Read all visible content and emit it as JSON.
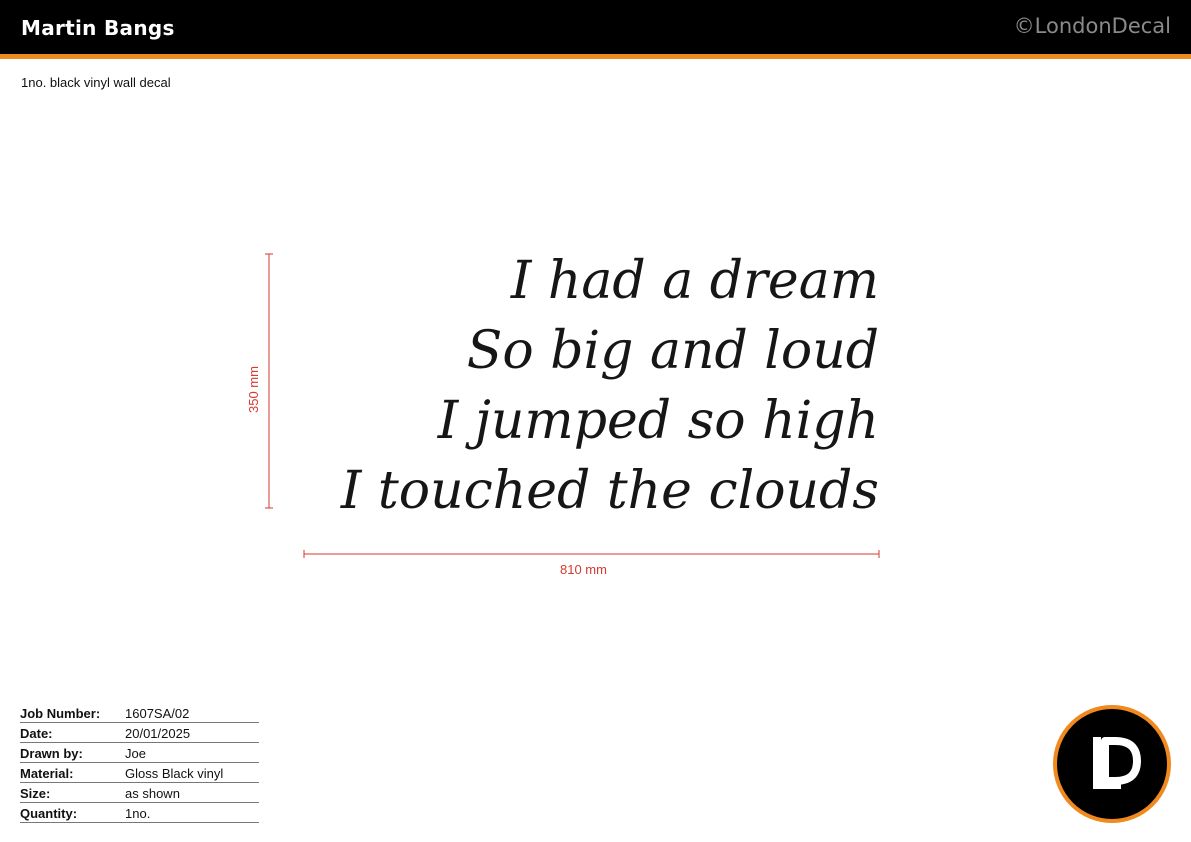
{
  "header": {
    "client_name": "Martin Bangs",
    "copyright": "©LondonDecal",
    "accent_color": "#f0891e",
    "background_color": "#000000"
  },
  "subtitle": "1no. black vinyl wall decal",
  "decal": {
    "lines": [
      "I had a dream",
      "So big and loud",
      "I jumped so high",
      "I touched the clouds"
    ],
    "color": "#161616"
  },
  "dimensions": {
    "width_label": "810 mm",
    "height_label": "350 mm",
    "line_color": "#d5392f"
  },
  "specs": [
    {
      "label": "Job Number:",
      "value": "1607SA/02"
    },
    {
      "label": "Date:",
      "value": "20/01/2025"
    },
    {
      "label": "Drawn by:",
      "value": "Joe"
    },
    {
      "label": "Material:",
      "value": "Gloss Black vinyl"
    },
    {
      "label": "Size:",
      "value": "as shown"
    },
    {
      "label": "Quantity:",
      "value": "1no."
    }
  ],
  "logo": {
    "icon": "londondecal-ld-logo",
    "ring_color": "#f0891e"
  }
}
